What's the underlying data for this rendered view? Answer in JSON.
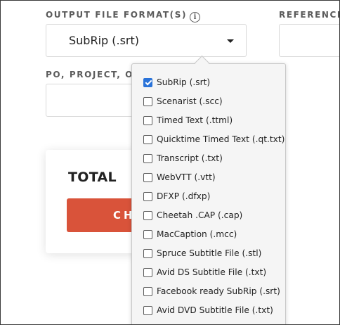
{
  "form": {
    "output_format_label": "OUTPUT FILE FORMAT(S)",
    "info_glyph": "i",
    "reference_label": "REFERENCE",
    "po_label": "PO, PROJECT, OR",
    "selected_format": "SubRip (.srt)"
  },
  "total": {
    "label": "TOTAL",
    "button_text": "CHECKOUT"
  },
  "dropdown": {
    "options": [
      {
        "label": "SubRip (.srt)",
        "checked": true
      },
      {
        "label": "Scenarist (.scc)",
        "checked": false
      },
      {
        "label": "Timed Text (.ttml)",
        "checked": false
      },
      {
        "label": "Quicktime Timed Text (.qt.txt)",
        "checked": false
      },
      {
        "label": "Transcript (.txt)",
        "checked": false
      },
      {
        "label": "WebVTT (.vtt)",
        "checked": false
      },
      {
        "label": "DFXP (.dfxp)",
        "checked": false
      },
      {
        "label": "Cheetah .CAP (.cap)",
        "checked": false
      },
      {
        "label": "MacCaption (.mcc)",
        "checked": false
      },
      {
        "label": "Spruce Subtitle File (.stl)",
        "checked": false
      },
      {
        "label": "Avid DS Subtitle File (.txt)",
        "checked": false
      },
      {
        "label": "Facebook ready SubRip (.srt)",
        "checked": false
      },
      {
        "label": "Avid DVD Subtitle File (.txt)",
        "checked": false
      }
    ]
  },
  "colors": {
    "accent_checkbox": "#2a73d9",
    "checkout_button": "#d9533a"
  },
  "icons": {
    "info": "info-icon",
    "caret": "chevron-down-icon",
    "checked": "checkbox-checked-icon"
  }
}
